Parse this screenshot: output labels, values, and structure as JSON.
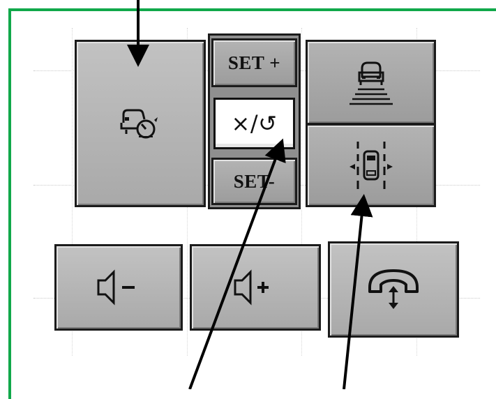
{
  "buttons": {
    "cruise_mode": {
      "icon": "cruise-control-icon"
    },
    "set_plus": {
      "label": "SET +"
    },
    "cancel_resume": {
      "label": "×/↺",
      "icon": "cancel-resume-icon"
    },
    "set_minus": {
      "label": "SET-"
    },
    "following_distance": {
      "icon": "following-distance-icon"
    },
    "lane_keeping": {
      "icon": "lane-keep-assist-icon"
    },
    "volume_down": {
      "icon": "volume-down-icon"
    },
    "volume_up": {
      "icon": "volume-up-icon"
    },
    "phone": {
      "icon": "phone-answer-end-icon"
    }
  },
  "colors": {
    "frame": "#11a84a",
    "button_face": "#b5b5b5",
    "button_border": "#1b1b1b",
    "arrow": "#000000"
  }
}
